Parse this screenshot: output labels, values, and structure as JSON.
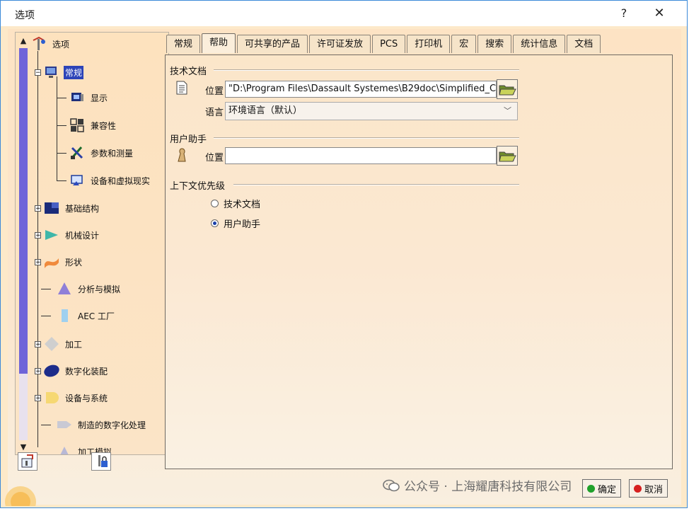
{
  "window": {
    "title": "选项",
    "help_button": "?",
    "close_button": "✕"
  },
  "tree": {
    "root": "选项",
    "items": [
      {
        "label": "常规",
        "selected": true
      },
      {
        "label": "显示"
      },
      {
        "label": "兼容性"
      },
      {
        "label": "参数和测量"
      },
      {
        "label": "设备和虚拟现实"
      },
      {
        "label": "基础结构"
      },
      {
        "label": "机械设计"
      },
      {
        "label": "形状"
      },
      {
        "label": "分析与模拟"
      },
      {
        "label": "AEC 工厂"
      },
      {
        "label": "加工"
      },
      {
        "label": "数字化装配"
      },
      {
        "label": "设备与系统"
      },
      {
        "label": "制造的数字化处理"
      },
      {
        "label": "加工模拟"
      }
    ]
  },
  "tabs": [
    {
      "label": "常规"
    },
    {
      "label": "帮助",
      "active": true
    },
    {
      "label": "可共享的产品"
    },
    {
      "label": "许可证发放"
    },
    {
      "label": "PCS"
    },
    {
      "label": "打印机"
    },
    {
      "label": "宏"
    },
    {
      "label": "搜索"
    },
    {
      "label": "统计信息"
    },
    {
      "label": "文档"
    }
  ],
  "tech_doc": {
    "section_title": "技术文档",
    "location_label": "位置",
    "location_value": "\"D:\\Program Files\\Dassault Systemes\\B29doc\\Simplified_C",
    "language_label": "语言",
    "language_value": "环境语言（默认）"
  },
  "user_assistant": {
    "section_title": "用户助手",
    "location_label": "位置",
    "location_value": ""
  },
  "context_priority": {
    "section_title": "上下文优先级",
    "options": [
      {
        "label": "技术文档",
        "checked": false
      },
      {
        "label": "用户助手",
        "checked": true
      }
    ]
  },
  "buttons": {
    "ok": "确定",
    "cancel": "取消"
  },
  "watermark": "公众号 · 上海耀唐科技有限公司",
  "colors": {
    "accent": "#2d44b8",
    "scroll_thumb": "#6e64d9",
    "ok_green": "#1fa12b",
    "cancel_red": "#d62020"
  }
}
